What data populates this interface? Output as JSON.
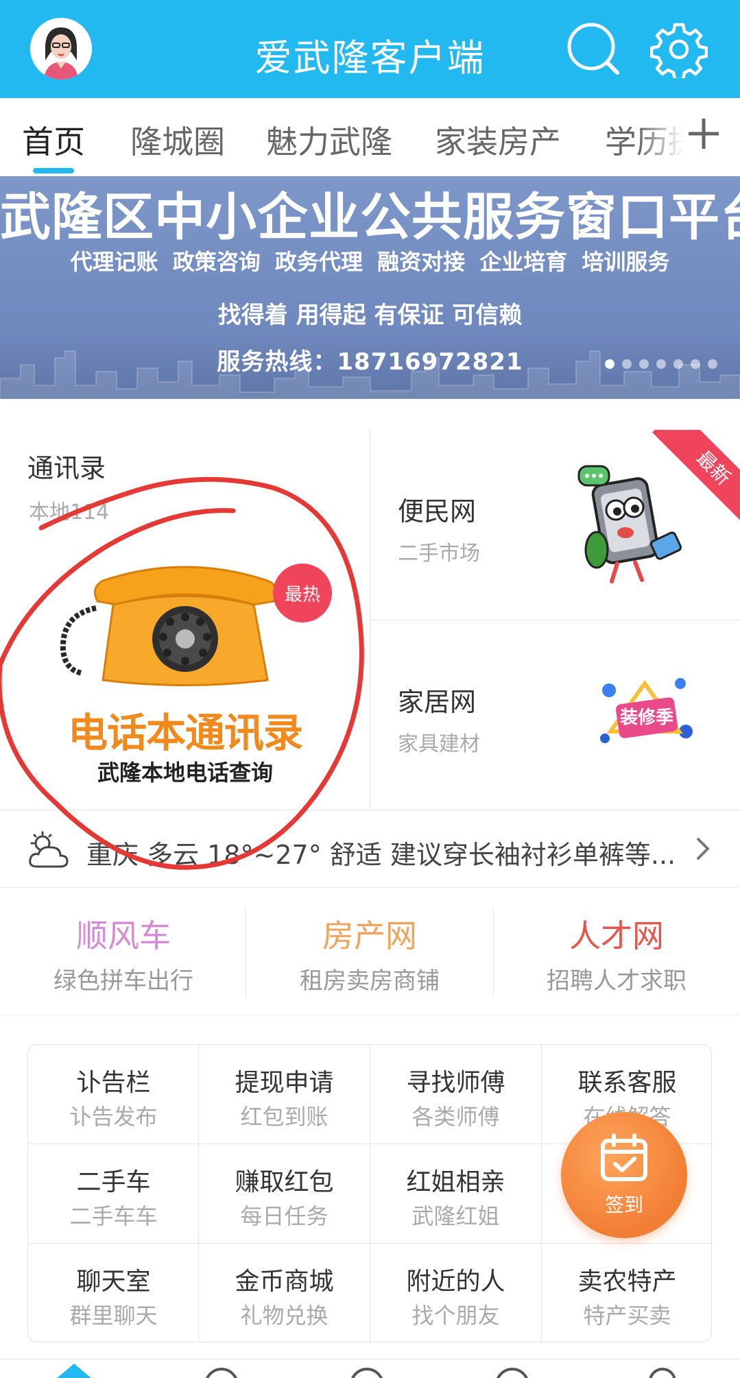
{
  "header": {
    "title": "爱武隆客户端",
    "avatar_icon": "avatar-woman",
    "search_icon": "search-icon",
    "settings_icon": "gear-icon"
  },
  "tabs": [
    {
      "label": "首页",
      "active": true
    },
    {
      "label": "隆城圈"
    },
    {
      "label": "魅力武隆"
    },
    {
      "label": "家装房产"
    },
    {
      "label": "学历提"
    }
  ],
  "banner": {
    "title": "武隆区中小企业公共服务窗口平台",
    "services": "代理记账 政策咨询 政务代理 融资对接 企业培育 培训服务",
    "slogan": "找得着 用得起 有保证 可信赖",
    "hotline": "服务热线：18716972821",
    "slide_count": 7,
    "active_slide": 1
  },
  "features": {
    "contacts": {
      "title": "通讯录",
      "subtitle": "本地114",
      "badge": "最热",
      "caption_big": "电话本通讯录",
      "caption_small": "武隆本地电话查询"
    },
    "convenience": {
      "title": "便民网",
      "subtitle": "二手市场",
      "ribbon": "最新"
    },
    "home": {
      "title": "家居网",
      "subtitle": "家具建材",
      "logo_text": "装修季"
    }
  },
  "weather": {
    "text": "重庆 多云 18°~27° 舒适 建议穿长袖衬衫单裤等...",
    "icon": "cloud-sun-icon"
  },
  "quick_links": [
    {
      "title": "顺风车",
      "subtitle": "绿色拼车出行",
      "color": "#d58ad6"
    },
    {
      "title": "房产网",
      "subtitle": "租房卖房商铺",
      "color": "#f0a35b"
    },
    {
      "title": "人才网",
      "subtitle": "招聘人才求职",
      "color": "#e8544f"
    }
  ],
  "services": [
    {
      "title": "讣告栏",
      "subtitle": "讣告发布"
    },
    {
      "title": "提现申请",
      "subtitle": "红包到账"
    },
    {
      "title": "寻找师傅",
      "subtitle": "各类师傅"
    },
    {
      "title": "联系客服",
      "subtitle": "在线解答"
    },
    {
      "title": "二手车",
      "subtitle": "二手车车"
    },
    {
      "title": "赚取红包",
      "subtitle": "每日任务"
    },
    {
      "title": "红姐相亲",
      "subtitle": "武隆红姐"
    },
    {
      "title": "",
      "subtitle": ""
    },
    {
      "title": "聊天室",
      "subtitle": "群里聊天"
    },
    {
      "title": "金币商城",
      "subtitle": "礼物兑换"
    },
    {
      "title": "附近的人",
      "subtitle": "找个朋友"
    },
    {
      "title": "卖农特产",
      "subtitle": "特产买卖"
    }
  ],
  "signin": {
    "label": "签到",
    "icon": "calendar-check-icon"
  },
  "colors": {
    "brand": "#22b9f1",
    "annotation": "#e53935",
    "accent_orange": "#f27d34"
  }
}
